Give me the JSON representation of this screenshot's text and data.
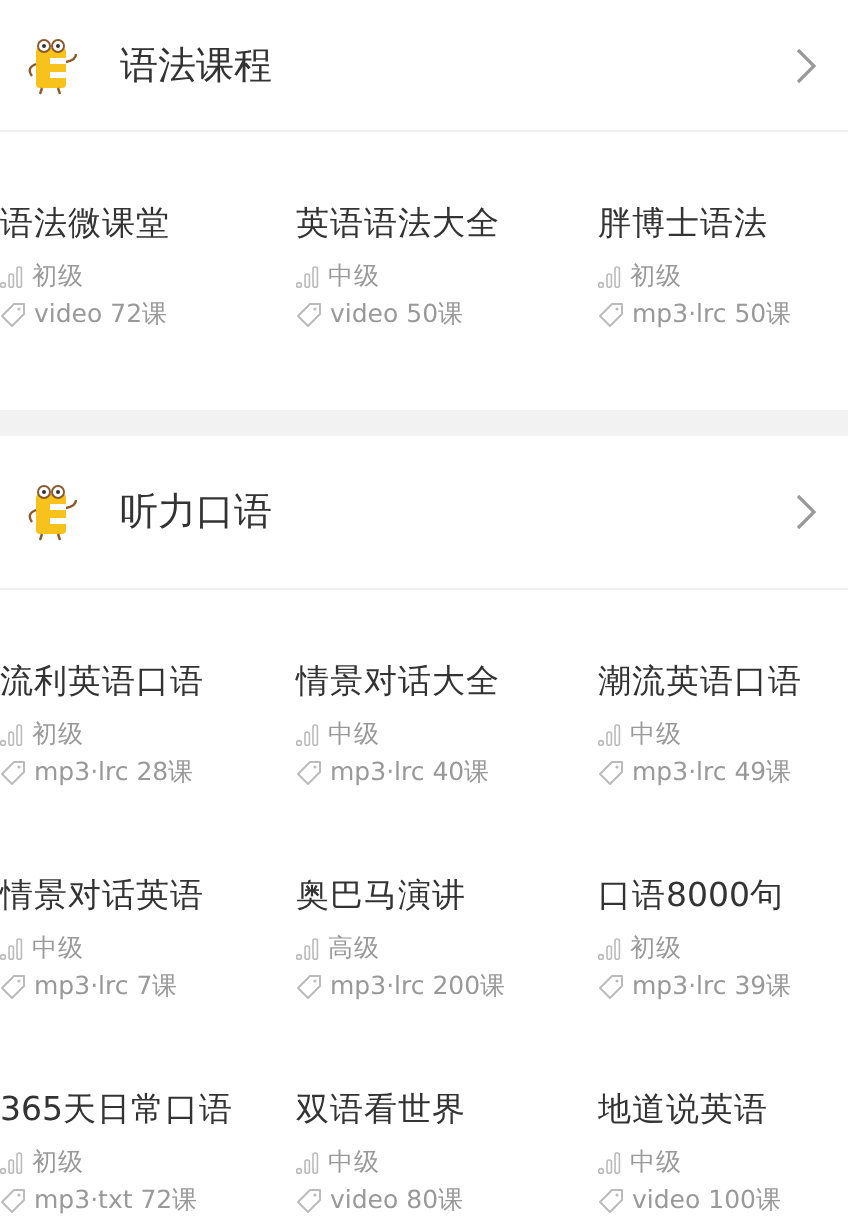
{
  "sections": [
    {
      "title": "语法课程",
      "courses": [
        {
          "title": "语法微课堂",
          "level": "初级",
          "format": "video 72课"
        },
        {
          "title": "英语语法大全",
          "level": "中级",
          "format": "video 50课"
        },
        {
          "title": "胖博士语法",
          "level": "初级",
          "format": "mp3·lrc 50课"
        }
      ]
    },
    {
      "title": "听力口语",
      "courses": [
        {
          "title": "流利英语口语",
          "level": "初级",
          "format": "mp3·lrc 28课"
        },
        {
          "title": "情景对话大全",
          "level": "中级",
          "format": "mp3·lrc 40课"
        },
        {
          "title": "潮流英语口语",
          "level": "中级",
          "format": "mp3·lrc 49课"
        },
        {
          "title": "情景对话英语",
          "level": "中级",
          "format": "mp3·lrc 7课"
        },
        {
          "title": "奥巴马演讲",
          "level": "高级",
          "format": "mp3·lrc 200课"
        },
        {
          "title": "口语8000句",
          "level": "初级",
          "format": "mp3·lrc 39课"
        },
        {
          "title": "365天日常口语",
          "level": "初级",
          "format": "mp3·txt 72课"
        },
        {
          "title": "双语看世界",
          "level": "中级",
          "format": "video 80课"
        },
        {
          "title": "地道说英语",
          "level": "中级",
          "format": "video 100课"
        }
      ]
    }
  ]
}
